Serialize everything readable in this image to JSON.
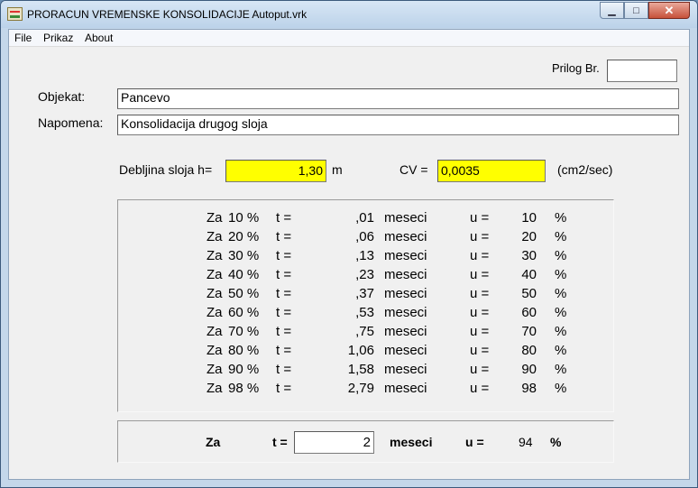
{
  "window": {
    "title": "PRORACUN VREMENSKE KONSOLIDACIJE  Autoput.vrk",
    "minimize_glyph": "▁",
    "maximize_glyph": "□",
    "close_glyph": "✕"
  },
  "menu": [
    "File",
    "Prikaz",
    "About"
  ],
  "form": {
    "prilog_label": "Prilog Br.",
    "prilog_value": "",
    "objekat_label": "Objekat:",
    "objekat_value": "Pancevo",
    "napomena_label": "Napomena:",
    "napomena_value": "Konsolidacija drugog sloja",
    "debljina_label": "Debljina sloja  h=",
    "debljina_value": "1,30",
    "debljina_unit": "m",
    "cv_label": "CV  =",
    "cv_value": "0,0035",
    "cv_unit": "(cm2/sec)"
  },
  "results": [
    {
      "za": "Za",
      "pct": "10 %",
      "t_eq": "t =",
      "t": ",01",
      "unit": "meseci",
      "u_eq": "u =",
      "u": "10",
      "u_pct": "%"
    },
    {
      "za": "Za",
      "pct": "20 %",
      "t_eq": "t =",
      "t": ",06",
      "unit": "meseci",
      "u_eq": "u =",
      "u": "20",
      "u_pct": "%"
    },
    {
      "za": "Za",
      "pct": "30 %",
      "t_eq": "t =",
      "t": ",13",
      "unit": "meseci",
      "u_eq": "u =",
      "u": "30",
      "u_pct": "%"
    },
    {
      "za": "Za",
      "pct": "40 %",
      "t_eq": "t =",
      "t": ",23",
      "unit": "meseci",
      "u_eq": "u =",
      "u": "40",
      "u_pct": "%"
    },
    {
      "za": "Za",
      "pct": "50 %",
      "t_eq": "t =",
      "t": ",37",
      "unit": "meseci",
      "u_eq": "u =",
      "u": "50",
      "u_pct": "%"
    },
    {
      "za": "Za",
      "pct": "60 %",
      "t_eq": "t =",
      "t": ",53",
      "unit": "meseci",
      "u_eq": "u =",
      "u": "60",
      "u_pct": "%"
    },
    {
      "za": "Za",
      "pct": "70 %",
      "t_eq": "t =",
      "t": ",75",
      "unit": "meseci",
      "u_eq": "u =",
      "u": "70",
      "u_pct": "%"
    },
    {
      "za": "Za",
      "pct": "80 %",
      "t_eq": "t =",
      "t": "1,06",
      "unit": "meseci",
      "u_eq": "u =",
      "u": "80",
      "u_pct": "%"
    },
    {
      "za": "Za",
      "pct": "90 %",
      "t_eq": "t =",
      "t": "1,58",
      "unit": "meseci",
      "u_eq": "u =",
      "u": "90",
      "u_pct": "%"
    },
    {
      "za": "Za",
      "pct": "98 %",
      "t_eq": "t =",
      "t": "2,79",
      "unit": "meseci",
      "u_eq": "u =",
      "u": "98",
      "u_pct": "%"
    }
  ],
  "calc": {
    "za": "Za",
    "t_label": "t =",
    "t_value": "2",
    "unit": "meseci",
    "u_label": "u =",
    "u_value": "94",
    "u_pct": "%"
  }
}
